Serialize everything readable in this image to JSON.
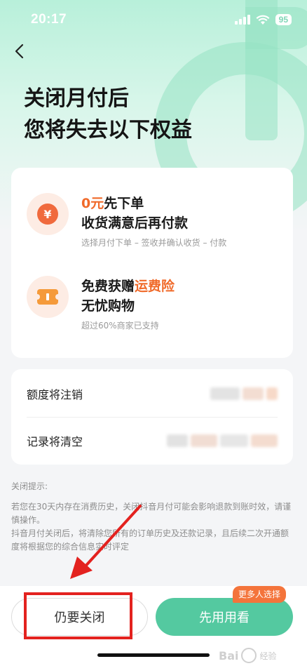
{
  "status": {
    "time": "20:17",
    "battery": "95"
  },
  "page": {
    "title_line1": "关闭月付后",
    "title_line2": "您将失去以下权益"
  },
  "benefits": [
    {
      "highlight": "0元",
      "line1_rest": "先下单",
      "line2": "收货满意后再付款",
      "sub": "选择月付下单 – 签收并确认收货 – 付款",
      "icon_char": "¥"
    },
    {
      "line1_prefix": "免费获赠",
      "highlight": "运费险",
      "line2": "无忧购物",
      "sub": "超过60%商家已支持"
    }
  ],
  "losses": [
    {
      "label": "额度将注销"
    },
    {
      "label": "记录将清空"
    }
  ],
  "notice": {
    "title": "关闭提示:",
    "p1": "若您在30天内存在消费历史，关闭抖音月付可能会影响退款到账时效，请谨慎操作。",
    "p2": "抖音月付关闭后，将清除您所有的订单历史及还款记录，且后续二次开通额度将根据您的综合信息实时评定"
  },
  "actions": {
    "close_label": "仍要关闭",
    "try_label": "先用用看",
    "badge": "更多人选择"
  },
  "watermark": {
    "big": "Bai",
    "small": "经验"
  },
  "colors": {
    "accent_green": "#54c9a0",
    "accent_orange": "#f06a2a",
    "annotation_red": "#e3221f"
  }
}
